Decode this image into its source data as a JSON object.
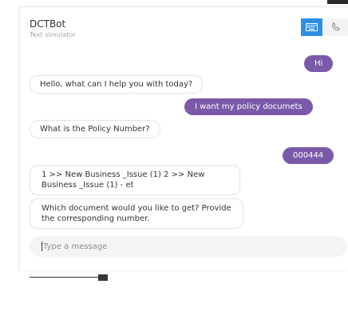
{
  "header": {
    "title": "DCTBot",
    "subtitle": "Text simulator",
    "modes": [
      {
        "icon": "keyboard-icon",
        "active": true
      },
      {
        "icon": "phone-icon",
        "active": false
      }
    ]
  },
  "messages": [
    {
      "sender": "user",
      "text": "Hi"
    },
    {
      "sender": "bot",
      "text": "Hello, what can I help you with today?"
    },
    {
      "sender": "user",
      "text": "I want my policy documets"
    },
    {
      "sender": "bot",
      "text": "What is the Policy Number?"
    },
    {
      "sender": "user",
      "text": "000444"
    },
    {
      "sender": "bot",
      "text": "1 >> New Business _Issue (1) 2 >> New Business _Issue (1) - et"
    },
    {
      "sender": "bot",
      "text": "Which document would you like to get? Provide the corresponding number."
    }
  ],
  "composer": {
    "placeholder": "Type a message",
    "value": ""
  },
  "colors": {
    "user_bubble": "#7a5aa8",
    "active_mode": "#2f8ee6",
    "bot_bubble_border": "#e3e3e3"
  }
}
